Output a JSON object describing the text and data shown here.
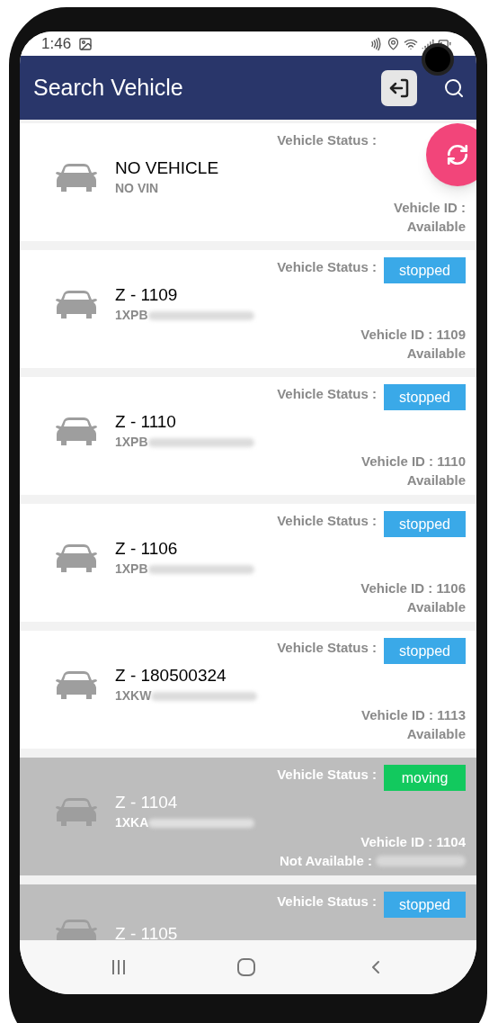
{
  "status_bar": {
    "time": "1:46"
  },
  "app_bar": {
    "title": "Search Vehicle"
  },
  "vehicles": [
    {
      "name": "NO VEHICLE",
      "vin": "NO VIN",
      "vin_redacted": false,
      "status_label": "Vehicle Status :",
      "id_label": "Vehicle ID :",
      "availability": "Available",
      "available": true
    },
    {
      "name": "Z - 1109",
      "vin": "1XPB",
      "vin_redacted": true,
      "status_label": "Vehicle Status :",
      "status": {
        "kind": "stopped",
        "label": "stopped"
      },
      "id_label": "Vehicle ID : 1109",
      "availability": "Available",
      "available": true
    },
    {
      "name": "Z - 1110",
      "vin": "1XPB",
      "vin_redacted": true,
      "status_label": "Vehicle Status :",
      "status": {
        "kind": "stopped",
        "label": "stopped"
      },
      "id_label": "Vehicle ID : 1110",
      "availability": "Available",
      "available": true
    },
    {
      "name": "Z - 1106",
      "vin": "1XPB",
      "vin_redacted": true,
      "status_label": "Vehicle Status :",
      "status": {
        "kind": "stopped",
        "label": "stopped"
      },
      "id_label": "Vehicle ID : 1106",
      "availability": "Available",
      "available": true
    },
    {
      "name": "Z - 180500324",
      "vin": "1XKW",
      "vin_redacted": true,
      "status_label": "Vehicle Status :",
      "status": {
        "kind": "stopped",
        "label": "stopped"
      },
      "id_label": "Vehicle ID : 1113",
      "availability": "Available",
      "available": true
    },
    {
      "name": "Z - 1104",
      "vin": "1XKA",
      "vin_redacted": true,
      "status_label": "Vehicle Status :",
      "status": {
        "kind": "moving",
        "label": "moving"
      },
      "id_label": "Vehicle ID : 1104",
      "availability": "Not Available :",
      "available": false
    },
    {
      "name": "Z - 1105",
      "status_label": "Vehicle Status :",
      "status": {
        "kind": "stopped",
        "label": "stopped"
      },
      "available": false
    }
  ]
}
